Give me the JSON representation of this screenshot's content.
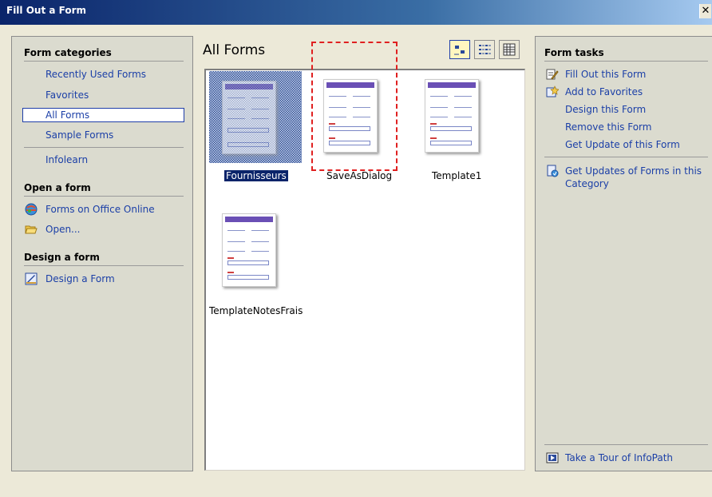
{
  "window": {
    "title": "Fill Out a Form",
    "close_glyph": "✕"
  },
  "left": {
    "categories_title": "Form categories",
    "categories": [
      {
        "label": "Recently Used Forms"
      },
      {
        "label": "Favorites"
      },
      {
        "label": "All Forms",
        "selected": true
      },
      {
        "label": "Sample Forms"
      }
    ],
    "infolearn": "Infolearn",
    "open_title": "Open a form",
    "open_items": [
      {
        "label": "Forms on Office Online",
        "icon": "globe-icon"
      },
      {
        "label": "Open...",
        "icon": "folder-open-icon"
      }
    ],
    "design_title": "Design a form",
    "design_items": [
      {
        "label": "Design a Form",
        "icon": "design-icon"
      }
    ]
  },
  "center": {
    "title": "All Forms",
    "views": [
      "large-icons-view",
      "list-view",
      "details-view"
    ],
    "forms": [
      {
        "label": "Fournisseurs",
        "selected": true
      },
      {
        "label": "SaveAsDialog"
      },
      {
        "label": "Template1"
      },
      {
        "label": "TemplateNotesFrais"
      }
    ]
  },
  "right": {
    "tasks_title": "Form tasks",
    "tasks": [
      {
        "label": "Fill Out this Form",
        "icon": "fill-out-icon"
      },
      {
        "label": "Add to Favorites",
        "icon": "favorites-icon"
      },
      {
        "label": "Design this Form"
      },
      {
        "label": "Remove this Form"
      },
      {
        "label": "Get Update of this Form"
      }
    ],
    "updates_line1": "Get Updates of Forms in this",
    "updates_line2": "Category",
    "tour": "Take a Tour of InfoPath"
  },
  "colors": {
    "link": "#1b3fa7",
    "selection": "#0a246a",
    "title_bar": "#0a246a",
    "annotation": "#e02020"
  }
}
